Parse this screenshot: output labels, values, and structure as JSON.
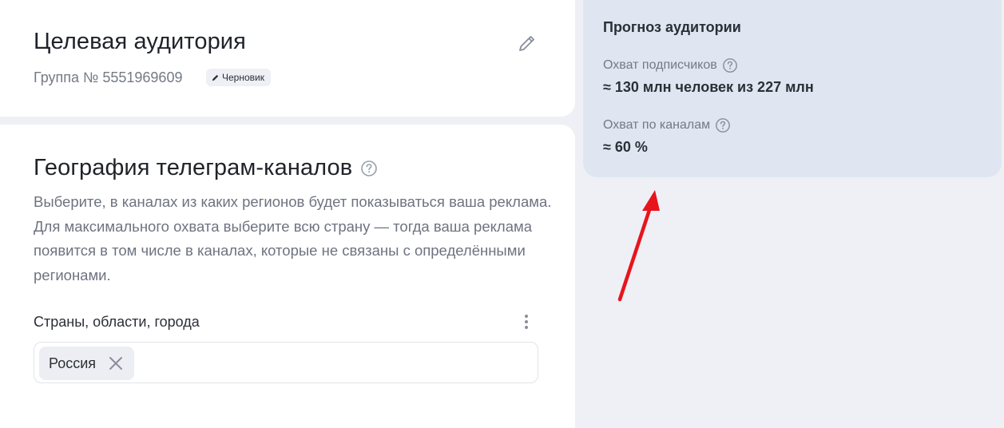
{
  "audience_card": {
    "title": "Целевая аудитория",
    "group_label": "Группа № 5551969609",
    "status_badge": "Черновик"
  },
  "geo_card": {
    "title": "География телеграм-каналов",
    "description": "Выберите, в каналах из каких регионов будет показываться ваша реклама. Для максимального охвата выберите всю страну — тогда ваша реклама появится в том числе в каналах, которые не связаны с определёнными регионами.",
    "field_label": "Страны, области, города",
    "selected_regions": [
      "Россия"
    ]
  },
  "forecast": {
    "title": "Прогноз аудитории",
    "subscribers_label": "Охват подписчиков",
    "subscribers_value": "≈ 130 млн человек из 227 млн",
    "channels_label": "Охват по каналам",
    "channels_value": "≈ 60 %"
  },
  "colors": {
    "page_bg": "#eef0f5",
    "forecast_bg": "#dfe6f1",
    "annotation_arrow": "#e8141c"
  },
  "icons": [
    "pencil-icon",
    "help-icon",
    "kebab-menu-icon",
    "close-icon",
    "annotation-arrow"
  ]
}
